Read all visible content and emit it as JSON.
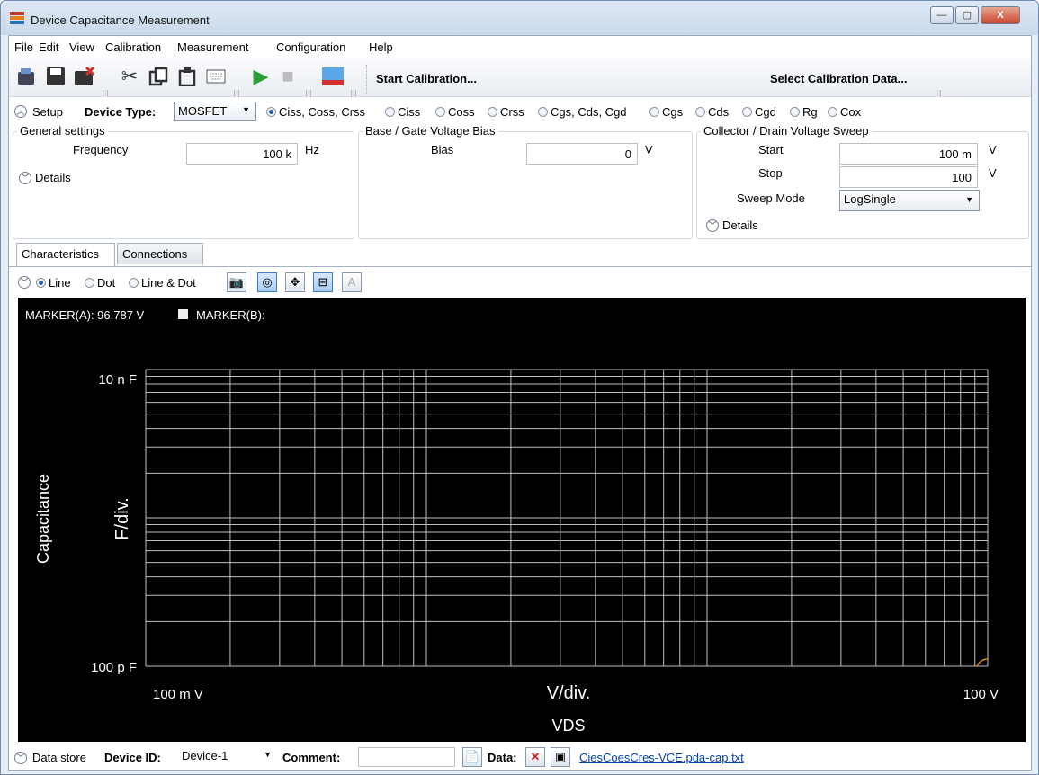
{
  "window": {
    "title": "Device Capacitance Measurement",
    "buttons": {
      "minimize": "—",
      "maximize": "▢",
      "close": "X"
    }
  },
  "menu": [
    "File",
    "Edit",
    "View",
    "Calibration",
    "Measurement",
    "Configuration",
    "Help"
  ],
  "toolbar": {
    "start_calibration": "Start Calibration...",
    "select_calibration": "Select Calibration Data..."
  },
  "setup": {
    "label": "Setup",
    "device_type_label": "Device Type:",
    "device_type": "MOSFET",
    "modes": [
      "Ciss, Coss, Crss",
      "Ciss",
      "Coss",
      "Crss",
      "Cgs, Cds, Cgd",
      "Cgs",
      "Cds",
      "Cgd",
      "Rg",
      "Cox"
    ],
    "selected_mode": "Ciss, Coss, Crss"
  },
  "general": {
    "title": "General settings",
    "frequency_label": "Frequency",
    "frequency": "100 k",
    "frequency_unit": "Hz",
    "details": "Details"
  },
  "bias": {
    "title": "Base / Gate Voltage Bias",
    "bias_label": "Bias",
    "bias": "0",
    "unit": "V"
  },
  "sweep": {
    "title": "Collector / Drain Voltage Sweep",
    "start_label": "Start",
    "start": "100 m",
    "start_unit": "V",
    "stop_label": "Stop",
    "stop": "100",
    "stop_unit": "V",
    "mode_label": "Sweep Mode",
    "mode": "LogSingle",
    "details": "Details"
  },
  "tabs": [
    "Characteristics",
    "Connections"
  ],
  "plot_styles": [
    "Line",
    "Dot",
    "Line & Dot"
  ],
  "selected_style": "Line",
  "chart_data": {
    "type": "line",
    "marker_a": "MARKER(A): 96.787 V",
    "marker_b": "MARKER(B):",
    "y_top_label": "10 n F",
    "y_bottom_label": "100 p F",
    "x_left_label": "100 m V",
    "x_right_label": "100  V",
    "x_div_label": "V/div.",
    "y_div_label": "F/div.",
    "xlabel": "VDS",
    "ylabel": "Capacitance",
    "xscale": "log",
    "xlim": [
      0.1,
      100
    ],
    "yscale": "log",
    "ylim": [
      1e-10,
      1e-08
    ],
    "grid": true,
    "series": [],
    "colors": {
      "background": "#000000",
      "grid": "#bfbfbf",
      "text": "#ffffff",
      "marker": "#d08a20"
    }
  },
  "datastore": {
    "label": "Data store",
    "device_id_label": "Device ID:",
    "device_id": "Device-1",
    "comment_label": "Comment:",
    "comment": "",
    "data_label": "Data:",
    "file": "CiesCoesCres-VCE.pda-cap.txt"
  }
}
